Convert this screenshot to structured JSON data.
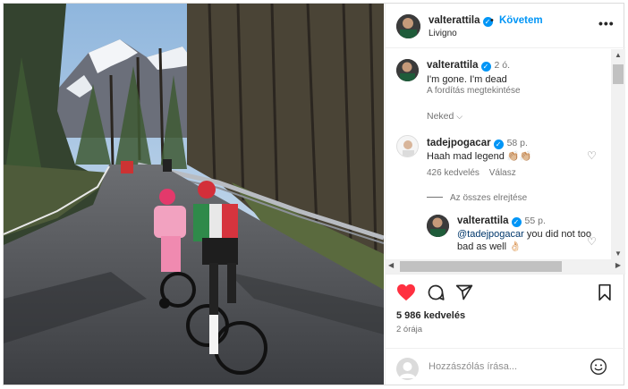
{
  "post": {
    "author": "valterattila",
    "follow_label": "Követem",
    "separator": "•",
    "location": "Livigno",
    "more_label": "•••"
  },
  "caption": {
    "user": "valterattila",
    "time": "2 ó.",
    "text": "I'm gone. I'm dead",
    "translate": "A fordítás megtekintése",
    "liked_by_label": "Neked"
  },
  "comments": [
    {
      "user": "tadejpogacar",
      "time": "58 p.",
      "text": "Haah mad legend 👏🏼👏🏼",
      "likes": "426 kedvelés",
      "reply_label": "Válasz",
      "hide_replies_label": "Az összes elrejtése"
    },
    {
      "user": "valterattila",
      "time": "55 p.",
      "mention": "@tadejpogacar",
      "text": " you did not too bad as well 👌🏻"
    }
  ],
  "stats": {
    "likes": "5 986 kedvelés",
    "ago": "2 órája"
  },
  "add_comment": {
    "placeholder": "Hozzászólás írása..."
  },
  "icons": {
    "like": "heart-filled-icon",
    "comment": "comment-icon",
    "share": "share-icon",
    "save": "bookmark-icon",
    "emoji": "emoji-icon",
    "more": "more-icon"
  },
  "colors": {
    "accent": "#0095f6",
    "like": "#ff3040",
    "text": "#262626",
    "muted": "#737373"
  }
}
